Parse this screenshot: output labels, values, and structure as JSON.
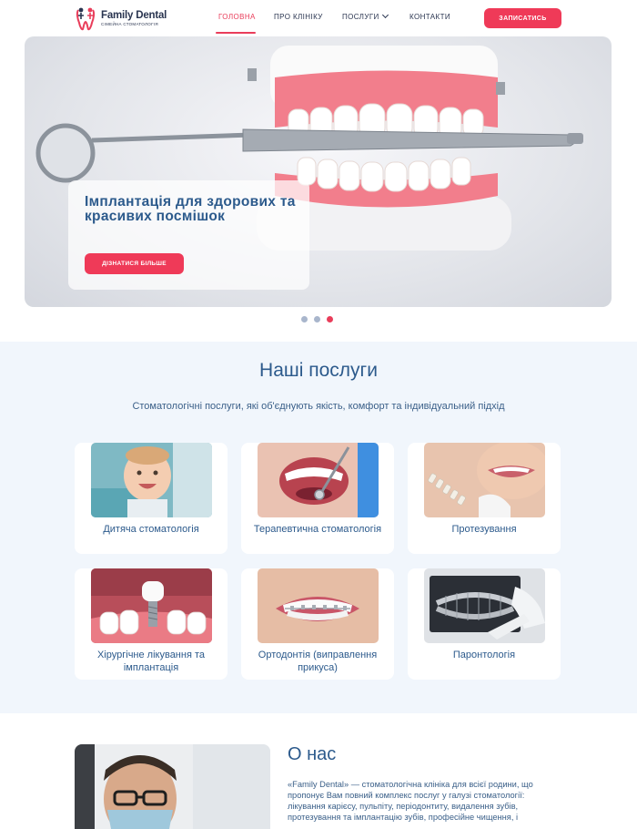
{
  "header": {
    "logo_title": "Family Dental",
    "logo_subtitle": "СІМЕЙНА СТОМАТОЛОГІЯ",
    "nav": [
      {
        "label": "ГОЛОВНА",
        "active": true
      },
      {
        "label": "ПРО КЛІНІКУ",
        "active": false
      },
      {
        "label": "ПОСЛУГИ",
        "active": false
      },
      {
        "label": "КОНТАКТИ",
        "active": false
      }
    ],
    "cta_label": "ЗАПИСАТИСЬ"
  },
  "hero": {
    "title": "Імплантація для здорових та красивих посмішок",
    "button_label": "ДІЗНАТИСЯ БІЛЬШЕ",
    "slides": 3,
    "active_slide": 3
  },
  "services": {
    "title": "Наші послуги",
    "subtitle": "Стоматологічні послуги, які об'єднують якість, комфорт та індивідуальний підхід",
    "items": [
      {
        "label": "Дитяча стоматологія"
      },
      {
        "label": "Терапевтична стоматологія"
      },
      {
        "label": "Протезування"
      },
      {
        "label": "Хірургічне лікування та імплантація"
      },
      {
        "label": "Ортодонтія (виправлення прикуса)"
      },
      {
        "label": "Паронтологія"
      }
    ]
  },
  "about": {
    "title": "О нас",
    "text": "«Family Dental» — стоматологічна клініка для всієї родини, що пропонує Вам повний комплекс послуг у галузі стоматології: лікування карієсу, пульпіту, періодонтиту, видалення зубів, протезування та імплантацію зубів, професійне чищення, і"
  },
  "colors": {
    "accent": "#ef3a58",
    "primary_text": "#2c5a8c",
    "section_bg": "#f1f6fc"
  }
}
